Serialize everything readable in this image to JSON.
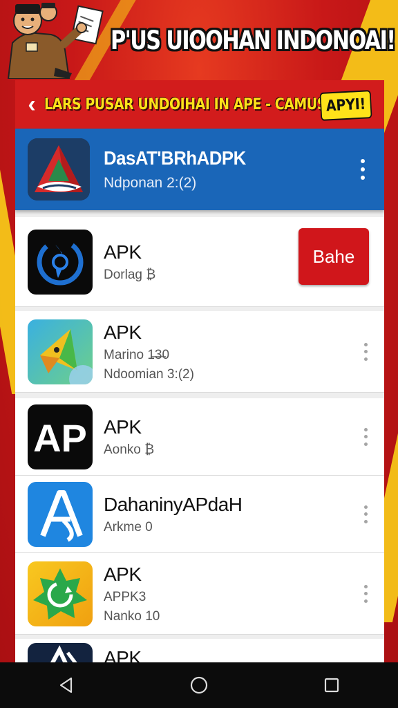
{
  "banner": {
    "title": "P'US UIOOHAN INDONOAI!"
  },
  "subheader": {
    "title": "LARS PUSAR UNDOIHAI IN APE - CAMUS!",
    "badge": "APYI!"
  },
  "featured": {
    "name": "DasAT'BRhADPK",
    "sub": "Ndponan 2:(2)"
  },
  "apps": [
    {
      "title": "APK",
      "line1": "Dorlag ₿",
      "line2": "",
      "action_label": "Bahe"
    },
    {
      "title": "APK",
      "line1": "Marino 1̶3̶0",
      "line2": "Ndoomian 3:(2)"
    },
    {
      "title": "APK",
      "line1": "Aonko ₿",
      "line2": ""
    },
    {
      "title": "DahaninyAPdaH",
      "line1": "Arkme 0",
      "line2": ""
    },
    {
      "title": "APK",
      "line1": "APPK3",
      "line2": "Nanko 10"
    },
    {
      "title": "APK",
      "line1": "",
      "line2": ""
    }
  ],
  "colors": {
    "accent_red": "#d21c1c",
    "accent_yellow": "#ffe21a",
    "featured_blue": "#1a66b8"
  },
  "icons": [
    "back-icon",
    "more-vert-icon",
    "nav-back-icon",
    "nav-home-icon",
    "nav-recents-icon"
  ]
}
